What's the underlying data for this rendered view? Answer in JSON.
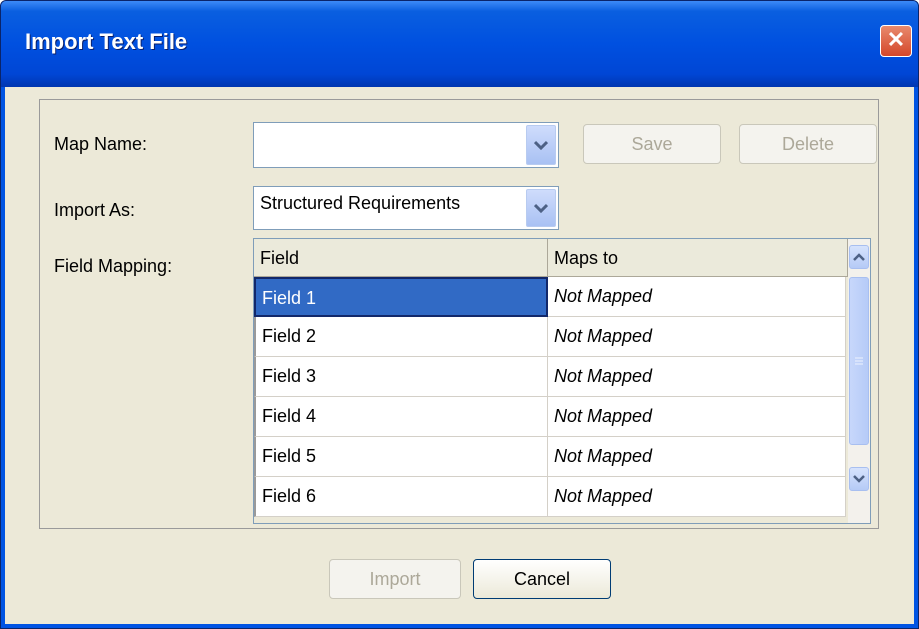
{
  "window": {
    "title": "Import Text File"
  },
  "form": {
    "map_name_label": "Map Name:",
    "map_name_value": "",
    "save_label": "Save",
    "delete_label": "Delete",
    "import_as_label": "Import As:",
    "import_as_value": "Structured Requirements",
    "field_mapping_label": "Field Mapping:"
  },
  "grid": {
    "columns": [
      "Field",
      "Maps to"
    ],
    "rows": [
      {
        "field": "Field 1",
        "maps_to": "Not Mapped"
      },
      {
        "field": "Field 2",
        "maps_to": "Not Mapped"
      },
      {
        "field": "Field 3",
        "maps_to": "Not Mapped"
      },
      {
        "field": "Field 4",
        "maps_to": "Not Mapped"
      },
      {
        "field": "Field 5",
        "maps_to": "Not Mapped"
      },
      {
        "field": "Field 6",
        "maps_to": "Not Mapped"
      }
    ]
  },
  "footer": {
    "import_label": "Import",
    "cancel_label": "Cancel"
  },
  "icons": {
    "close": "close-icon",
    "dropdown": "chevron-down-icon",
    "scroll_up": "arrow-up-icon",
    "scroll_down": "arrow-down-icon"
  },
  "colors": {
    "title_bar": "#0054e3",
    "selection": "#316ac5",
    "dialog_bg": "#ece9d8"
  }
}
